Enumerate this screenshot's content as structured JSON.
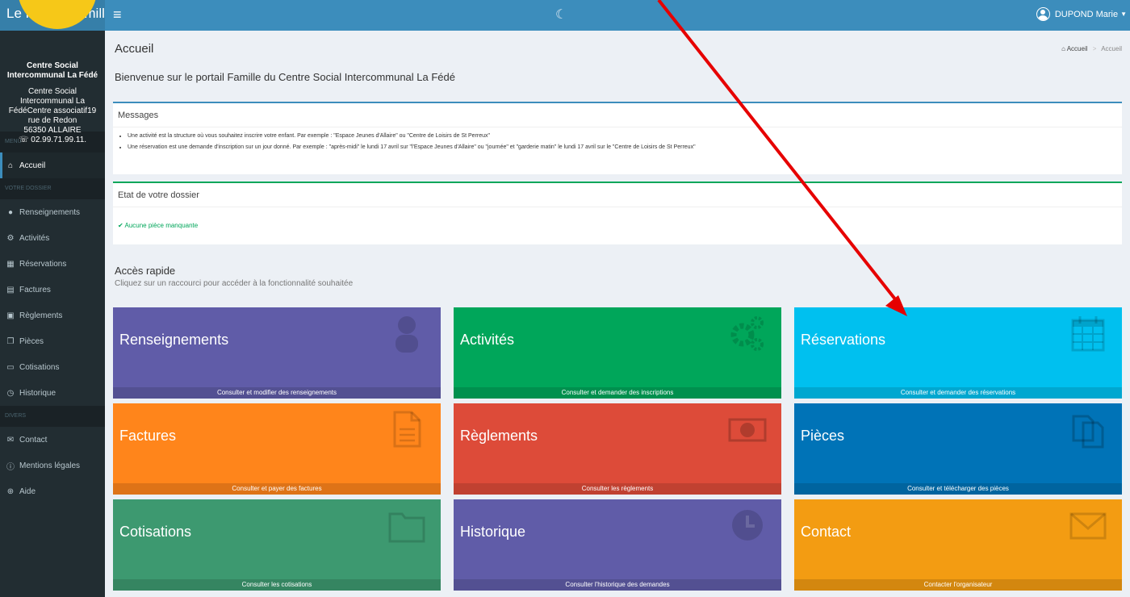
{
  "app": {
    "brand": "Le Portail Famille",
    "user_name": "DUPOND Marie"
  },
  "sidebar": {
    "org_name": "Centre Social Intercommunal La Fédé",
    "org_details": "Centre Social Intercommunal La FédéCentre associatif19 rue de Redon",
    "org_city": "56350 ALLAIRE",
    "org_phone": "02.99.71.99.11.",
    "headers": [
      "MENU",
      "VOTRE DOSSIER",
      "DIVERS"
    ],
    "items": [
      {
        "label": "Accueil",
        "icon": "home-icon"
      },
      {
        "label": "Renseignements",
        "icon": "user-icon"
      },
      {
        "label": "Activités",
        "icon": "gears-icon"
      },
      {
        "label": "Réservations",
        "icon": "calendar-icon"
      },
      {
        "label": "Factures",
        "icon": "file-icon"
      },
      {
        "label": "Règlements",
        "icon": "money-icon"
      },
      {
        "label": "Pièces",
        "icon": "copy-icon"
      },
      {
        "label": "Cotisations",
        "icon": "folder-icon"
      },
      {
        "label": "Historique",
        "icon": "clock-icon"
      },
      {
        "label": "Contact",
        "icon": "envelope-icon"
      },
      {
        "label": "Mentions légales",
        "icon": "info-icon"
      },
      {
        "label": "Aide",
        "icon": "lifebuoy-icon"
      }
    ]
  },
  "header": {
    "title": "Accueil",
    "breadcrumb": [
      "Accueil",
      "Accueil"
    ],
    "welcome": "Bienvenue sur le portail Famille du Centre Social Intercommunal La Fédé"
  },
  "messages": {
    "title": "Messages",
    "items": [
      "Une activité est la structure où vous souhaitez inscrire votre enfant. Par exemple : \"Espace Jeunes d'Allaire\" ou \"Centre de Loisirs de St Perreux\"",
      "Une réservation est une demande d'inscription sur un jour donné. Par exemple : \"après-midi\" le lundi 17 avril sur \"l'Espace Jeunes d'Allaire\" ou \"journée\" et \"garderie matin\" le lundi 17 avril sur le \"Centre de Loisirs de St Perreux\""
    ]
  },
  "dossier": {
    "title": "Etat de votre dossier",
    "status": "Aucune pièce manquante"
  },
  "quick_access": {
    "title": "Accès rapide",
    "subtitle": "Cliquez sur un raccourci pour accéder à la fonctionnalité souhaitée",
    "tiles": [
      {
        "title": "Renseignements",
        "footer": "Consulter et modifier des renseignements",
        "color": "#605ca8",
        "icon": "user-icon"
      },
      {
        "title": "Activités",
        "footer": "Consulter et demander des inscriptions",
        "color": "#00a65a",
        "icon": "gears-icon"
      },
      {
        "title": "Réservations",
        "footer": "Consulter et demander des réservations",
        "color": "#00c0ef",
        "icon": "calendar-icon"
      },
      {
        "title": "Factures",
        "footer": "Consulter et payer des factures",
        "color": "#ff851b",
        "icon": "file-icon"
      },
      {
        "title": "Règlements",
        "footer": "Consulter les règlements",
        "color": "#dd4b39",
        "icon": "money-icon"
      },
      {
        "title": "Pièces",
        "footer": "Consulter et télécharger des pièces",
        "color": "#0073b7",
        "icon": "copy-icon"
      },
      {
        "title": "Cotisations",
        "footer": "Consulter les cotisations",
        "color": "#3d9970",
        "icon": "folder-icon"
      },
      {
        "title": "Historique",
        "footer": "Consulter l'historique des demandes",
        "color": "#605ca8",
        "icon": "clock-icon"
      },
      {
        "title": "Contact",
        "footer": "Contacter l'organisateur",
        "color": "#f39c12",
        "icon": "envelope-icon"
      }
    ]
  },
  "colors": {
    "topbar": "#3c8dbc",
    "sidebar": "#222d32",
    "annotation_arrow": "#e60000",
    "logo_badge": "#f6c818"
  }
}
